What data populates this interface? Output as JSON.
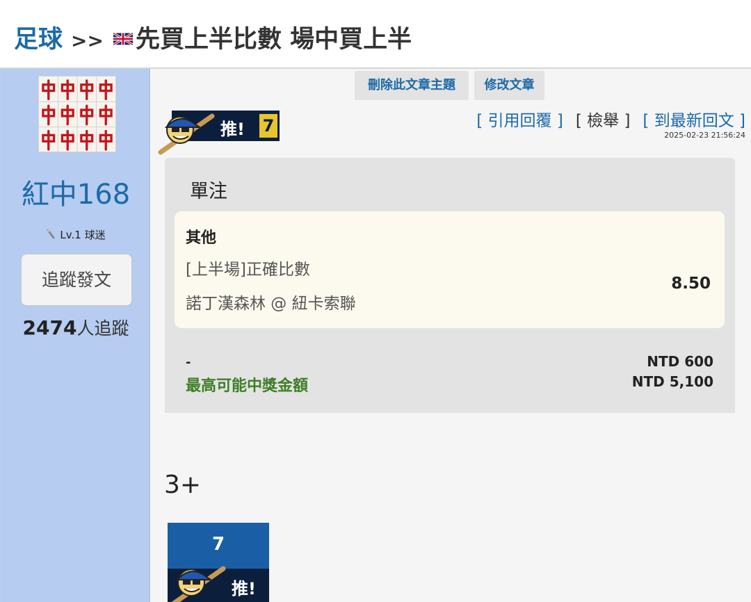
{
  "header": {
    "category": "足球",
    "separator": ">>",
    "flag_icon": "uk-flag-icon",
    "title": "先買上半比數 場中買上半"
  },
  "author": {
    "avatar_icon": "red-dragon-mahjong-tiles-avatar",
    "name": "紅中168",
    "level": "Lv.1 球迷",
    "follow_button": "追蹤發文",
    "follower_count": "2474",
    "follower_suffix": "人追蹤"
  },
  "admin": {
    "delete_label": "刪除此文章主題",
    "edit_label": "修改文章"
  },
  "push_badge": {
    "label": "推!",
    "count": "7"
  },
  "actions": {
    "quote_reply": "[ 引用回覆 ]",
    "report": "[ 檢舉 ]",
    "latest_reply": "[ 到最新回文 ]"
  },
  "timestamp": "2025-02-23 21:56:24",
  "bet_slip": {
    "bet_type": "單注",
    "selection": {
      "group": "其他",
      "market": "[上半場]正確比數",
      "match": "諾丁漢森林 @ 紐卡索聯",
      "odds": "8.50"
    },
    "dash": "-",
    "stake": "NTD 600",
    "max_payout_label": "最高可能中獎金額",
    "max_payout": "NTD 5,100"
  },
  "post_body": "3+",
  "push_box": {
    "count": "7",
    "label": "推!"
  },
  "colors": {
    "accent_blue": "#1c6aa8",
    "sidebar_bg": "#b6ccf0",
    "payout_green": "#3f7e26",
    "badge_navy": "#0b1f3d",
    "badge_yellow": "#e8c52c"
  }
}
